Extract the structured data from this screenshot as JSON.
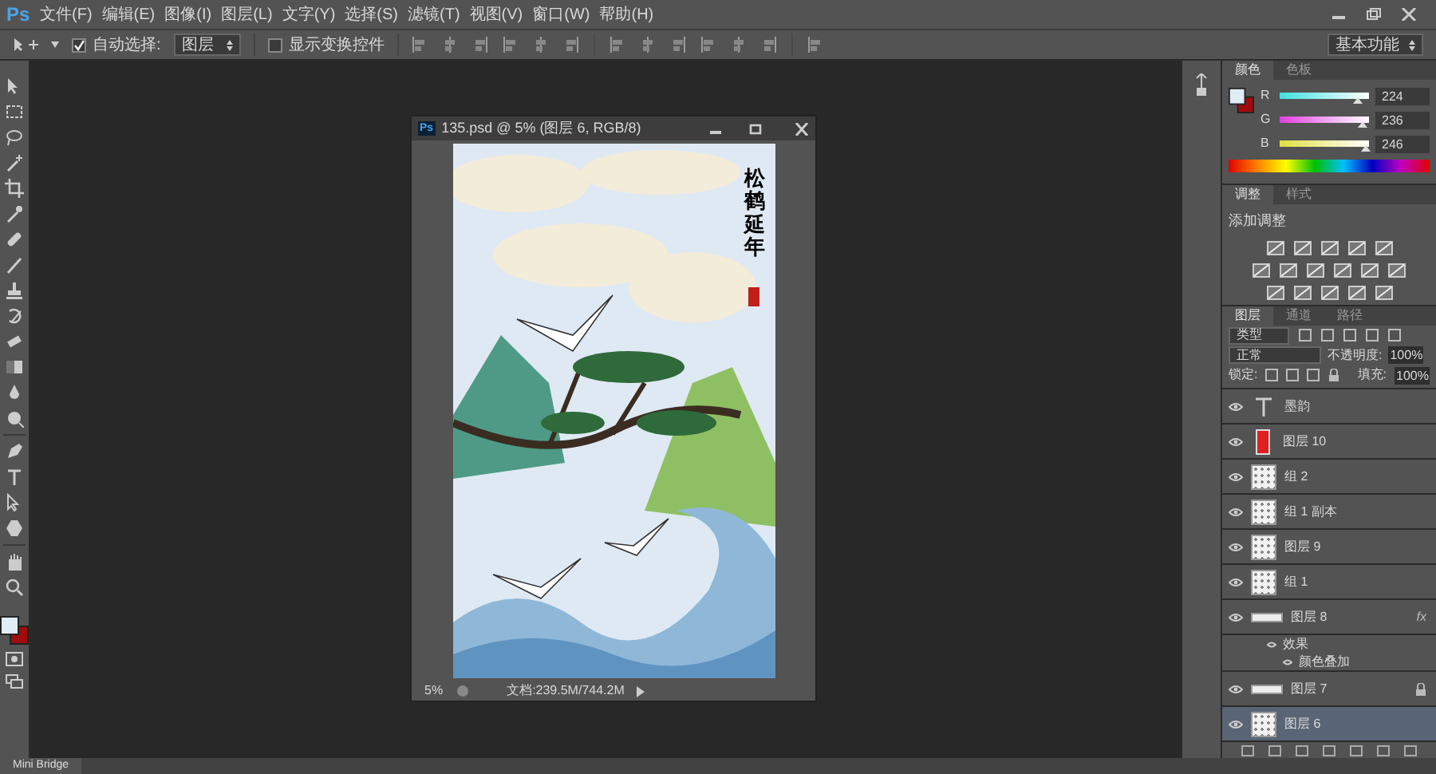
{
  "menu_bar": {
    "logo": "Ps",
    "items": [
      "文件(F)",
      "编辑(E)",
      "图像(I)",
      "图层(L)",
      "文字(Y)",
      "选择(S)",
      "滤镜(T)",
      "视图(V)",
      "窗口(W)",
      "帮助(H)"
    ]
  },
  "options_bar": {
    "auto_select": {
      "label": "自动选择:",
      "checked": true
    },
    "auto_select_target": "图层",
    "show_transform": {
      "label": "显示变换控件",
      "checked": false
    },
    "workspace": "基本功能"
  },
  "document": {
    "logo": "Ps",
    "title": "135.psd @ 5% (图层 6, RGB/8)",
    "artwork_title": "松鹤延年",
    "zoom": "5%",
    "status": "文档:239.5M/744.2M"
  },
  "color_panel": {
    "tabs": [
      {
        "label": "颜色",
        "selected": true
      },
      {
        "label": "色板",
        "selected": false
      }
    ],
    "channels": [
      {
        "name": "R",
        "value": "224",
        "level": 0.878
      },
      {
        "name": "G",
        "value": "236",
        "level": 0.925
      },
      {
        "name": "B",
        "value": "246",
        "level": 0.965
      }
    ]
  },
  "adjustments_panel": {
    "tabs": [
      {
        "label": "调整",
        "selected": true
      },
      {
        "label": "样式",
        "selected": false
      }
    ],
    "heading": "添加调整"
  },
  "layers_panel": {
    "tabs": [
      {
        "label": "图层",
        "selected": true
      },
      {
        "label": "通道",
        "selected": false
      },
      {
        "label": "路径",
        "selected": false
      }
    ],
    "filter": "类型",
    "blend_mode": "正常",
    "opacity_label": "不透明度:",
    "opacity": "100%",
    "lock_label": "锁定:",
    "fill_label": "填充:",
    "fill": "100%",
    "layers": [
      {
        "name": "墨韵",
        "kind": "text",
        "visible": true,
        "selected": false,
        "locked": false
      },
      {
        "name": "图层 10",
        "kind": "fill",
        "color": "#e02020",
        "visible": true,
        "selected": false,
        "locked": false
      },
      {
        "name": "组 2",
        "kind": "image",
        "visible": true,
        "selected": false,
        "locked": false
      },
      {
        "name": "组 1 副本",
        "kind": "image",
        "visible": true,
        "selected": false,
        "locked": false
      },
      {
        "name": "图层 9",
        "kind": "image",
        "visible": true,
        "selected": false,
        "locked": false
      },
      {
        "name": "组 1",
        "kind": "image",
        "visible": true,
        "selected": false,
        "locked": false
      },
      {
        "name": "图层 8",
        "kind": "strip",
        "visible": true,
        "selected": false,
        "locked": false,
        "fx_mark": "fx",
        "effects": {
          "label": "效果",
          "items": [
            "颜色叠加"
          ]
        }
      },
      {
        "name": "图层 7",
        "kind": "strip",
        "visible": true,
        "selected": false,
        "locked": true
      },
      {
        "name": "图层 6",
        "kind": "image",
        "visible": true,
        "selected": true,
        "locked": false
      }
    ]
  },
  "bottom_tabs": [
    {
      "label": "Mini Bridge",
      "selected": true
    }
  ]
}
